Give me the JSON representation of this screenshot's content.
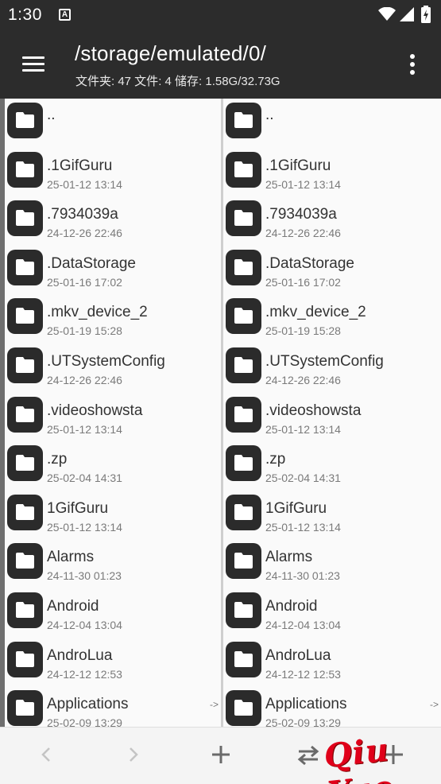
{
  "status_bar": {
    "time": "1:30",
    "notification_letter": "A"
  },
  "app_bar": {
    "title": "/storage/emulated/0/",
    "subtitle": "文件夹: 47  文件: 4  储存: 1.58G/32.73G"
  },
  "left_pane": {
    "items": [
      {
        "name": "..",
        "date": "",
        "arrow": ""
      },
      {
        "name": ".1GifGuru",
        "date": "25-01-12 13:14",
        "arrow": ""
      },
      {
        "name": ".7934039a",
        "date": "24-12-26 22:46",
        "arrow": ""
      },
      {
        "name": ".DataStorage",
        "date": "25-01-16 17:02",
        "arrow": ""
      },
      {
        "name": ".mkv_device_2",
        "date": "25-01-19 15:28",
        "arrow": ""
      },
      {
        "name": ".UTSystemConfig",
        "date": "24-12-26 22:46",
        "arrow": ""
      },
      {
        "name": ".videoshowsta",
        "date": "25-01-12 13:14",
        "arrow": ""
      },
      {
        "name": ".zp",
        "date": "25-02-04 14:31",
        "arrow": ""
      },
      {
        "name": "1GifGuru",
        "date": "25-01-12 13:14",
        "arrow": ""
      },
      {
        "name": "Alarms",
        "date": "24-11-30 01:23",
        "arrow": ""
      },
      {
        "name": "Android",
        "date": "24-12-04 13:04",
        "arrow": ""
      },
      {
        "name": "AndroLua",
        "date": "24-12-12 12:53",
        "arrow": ""
      },
      {
        "name": "Applications",
        "date": "25-02-09 13:29",
        "arrow": "->"
      }
    ]
  },
  "right_pane": {
    "items": [
      {
        "name": "..",
        "date": "",
        "arrow": ""
      },
      {
        "name": ".1GifGuru",
        "date": "25-01-12 13:14",
        "arrow": ""
      },
      {
        "name": ".7934039a",
        "date": "24-12-26 22:46",
        "arrow": ""
      },
      {
        "name": ".DataStorage",
        "date": "25-01-16 17:02",
        "arrow": ""
      },
      {
        "name": ".mkv_device_2",
        "date": "25-01-19 15:28",
        "arrow": ""
      },
      {
        "name": ".UTSystemConfig",
        "date": "24-12-26 22:46",
        "arrow": ""
      },
      {
        "name": ".videoshowsta",
        "date": "25-01-12 13:14",
        "arrow": ""
      },
      {
        "name": ".zp",
        "date": "25-02-04 14:31",
        "arrow": ""
      },
      {
        "name": "1GifGuru",
        "date": "25-01-12 13:14",
        "arrow": ""
      },
      {
        "name": "Alarms",
        "date": "24-11-30 01:23",
        "arrow": ""
      },
      {
        "name": "Android",
        "date": "24-12-04 13:04",
        "arrow": ""
      },
      {
        "name": "AndroLua",
        "date": "24-12-12 12:53",
        "arrow": ""
      },
      {
        "name": "Applications",
        "date": "25-02-09 13:29",
        "arrow": "->"
      }
    ]
  },
  "bottom_bar": {
    "icons": [
      "chevron-left-icon",
      "chevron-right-icon",
      "plus-icon",
      "swap-icon",
      "more-icon"
    ]
  },
  "watermark": "Qiu Yue",
  "colors": {
    "bar_background": "#2c2c2c",
    "folder_icon_background": "#2b2b2b",
    "watermark": "#e0001a"
  }
}
